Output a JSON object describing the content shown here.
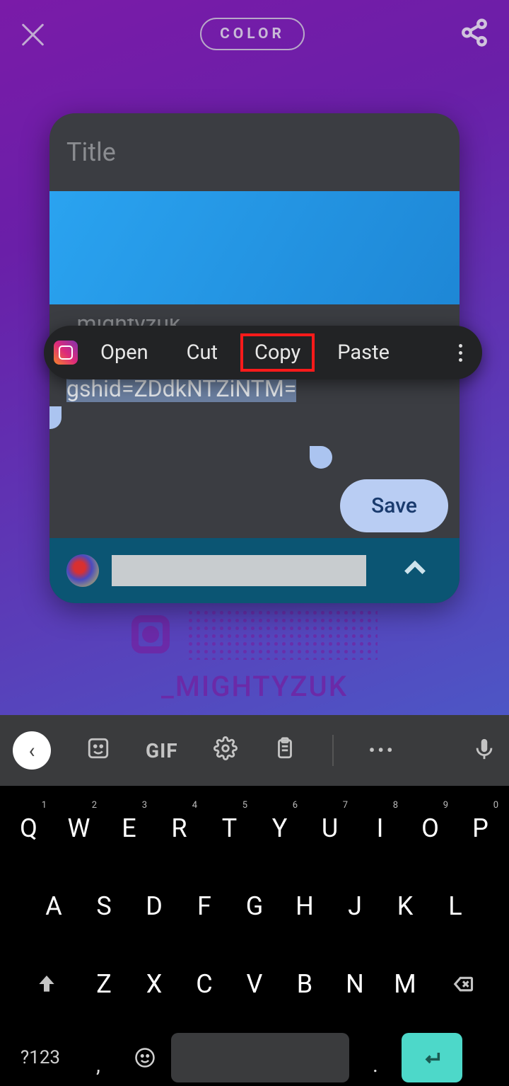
{
  "topbar": {
    "color_label": "COLOR"
  },
  "card": {
    "title_placeholder": "Title",
    "name_line": "_mightyzuk",
    "selected_url": "https://instagram.com/_mightyzuk?igshid=ZDdkNTZiNTM=",
    "save_label": "Save"
  },
  "qr": {
    "username": "_MIGHTYZUK"
  },
  "context_menu": {
    "open": "Open",
    "cut": "Cut",
    "copy": "Copy",
    "paste": "Paste"
  },
  "kbd_bar": {
    "gif": "GIF"
  },
  "keyboard": {
    "row1": [
      "Q",
      "W",
      "E",
      "R",
      "T",
      "Y",
      "U",
      "I",
      "O",
      "P"
    ],
    "nums": [
      "1",
      "2",
      "3",
      "4",
      "5",
      "6",
      "7",
      "8",
      "9",
      "0"
    ],
    "row2": [
      "A",
      "S",
      "D",
      "F",
      "G",
      "H",
      "J",
      "K",
      "L"
    ],
    "row3": [
      "Z",
      "X",
      "C",
      "V",
      "B",
      "N",
      "M"
    ],
    "fn": "?123",
    "comma": ",",
    "dot": "."
  }
}
